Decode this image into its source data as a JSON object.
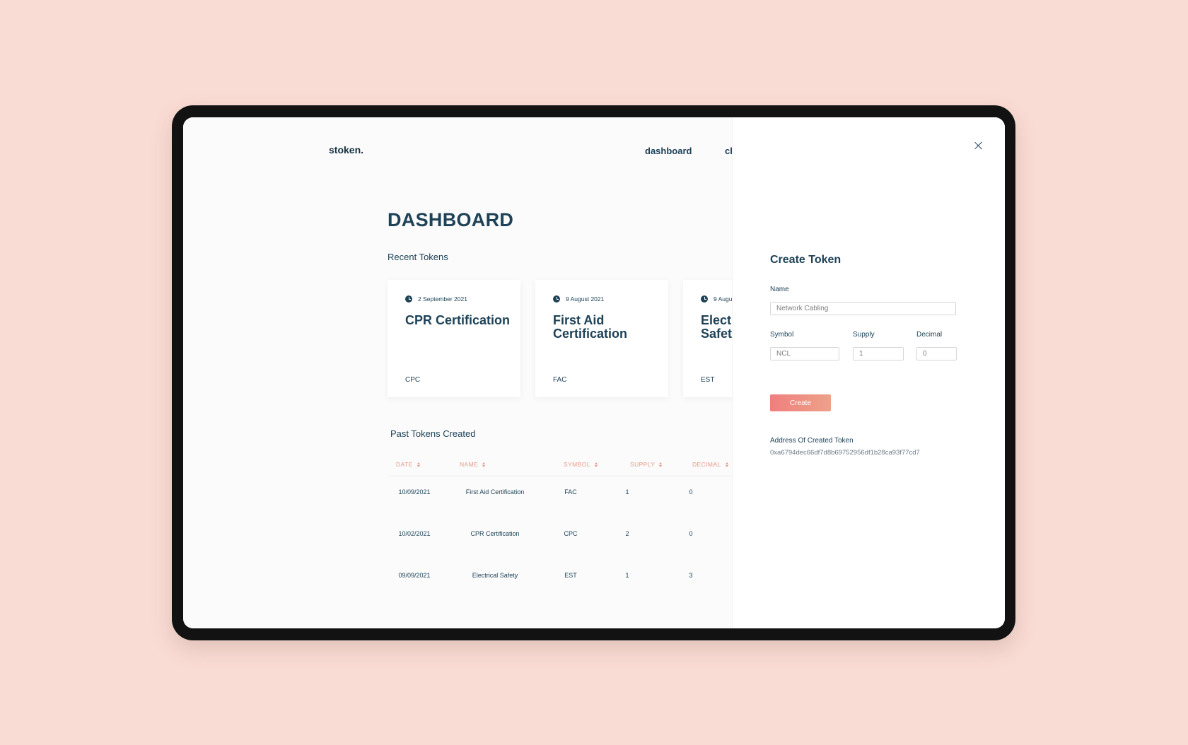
{
  "header": {
    "brand": "stoken.",
    "nav": [
      "dashboard",
      "ch"
    ]
  },
  "main": {
    "title": "DASHBOARD",
    "recent_title": "Recent Tokens",
    "recent_tokens": [
      {
        "date": "2 September 2021",
        "name": "CPR Certification",
        "symbol": "CPC"
      },
      {
        "date": "9 August 2021",
        "name": "First Aid Certification",
        "symbol": "FAC"
      },
      {
        "date": "9 Augu",
        "name": "Elect Safet",
        "symbol": "EST"
      }
    ],
    "past_title": "Past Tokens Created",
    "table": {
      "columns": [
        "DATE",
        "NAME",
        "SYMBOL",
        "SUPPLY",
        "DECIMAL"
      ],
      "rows": [
        [
          "10/09/2021",
          "First Aid Certification",
          "FAC",
          "1",
          "0"
        ],
        [
          "10/02/2021",
          "CPR Certification",
          "CPC",
          "2",
          "0"
        ],
        [
          "09/09/2021",
          "Electrical Safety",
          "EST",
          "1",
          "3"
        ]
      ]
    }
  },
  "panel": {
    "title": "Create Token",
    "name_label": "Name",
    "name_value": "Network Cabling",
    "symbol_label": "Symbol",
    "symbol_value": "NCL",
    "supply_label": "Supply",
    "supply_value": "1",
    "decimal_label": "Decimal",
    "decimal_value": "0",
    "create_label": "Create",
    "address_label": "Address Of Created Token",
    "address_value": "0xa6794dec66df7d8b69752956df1b28ca93f77cd7"
  },
  "colors": {
    "background": "#f9dcd4",
    "text": "#1e4257",
    "accent": "#ef7f7e",
    "table_header": "#e59a86"
  },
  "icons": {
    "close": "close-icon",
    "clock": "clock-icon",
    "sort": "sort-icon"
  }
}
